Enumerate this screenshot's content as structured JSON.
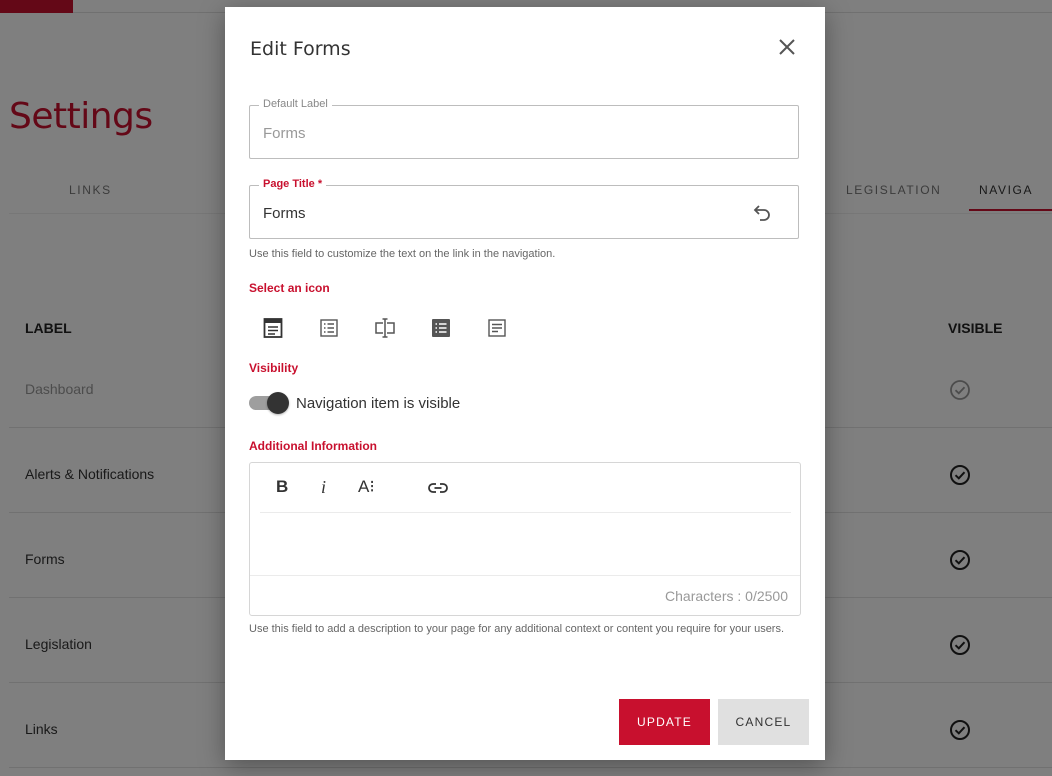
{
  "page": {
    "title": "Settings",
    "tabs": [
      {
        "label": "LINKS"
      },
      {
        "label": "LEGISLATION"
      },
      {
        "label": "NAVIGA"
      }
    ],
    "table": {
      "headers": {
        "label": "LABEL",
        "visible": "VISIBLE"
      },
      "rows": [
        {
          "label": "Dashboard",
          "icon": "check-circle-outline-icon"
        },
        {
          "label": "Alerts & Notifications",
          "icon": "check-circle-icon"
        },
        {
          "label": "Forms",
          "icon": "check-circle-icon"
        },
        {
          "label": "Legislation",
          "icon": "check-circle-icon"
        },
        {
          "label": "Links",
          "icon": "check-circle-icon"
        }
      ]
    }
  },
  "modal": {
    "title": "Edit Forms",
    "default_label": {
      "legend": "Default Label",
      "value": "Forms"
    },
    "page_title": {
      "legend": "Page Title *",
      "value": "Forms"
    },
    "page_title_help": "Use this field to customize the text on the link in the navigation.",
    "select_icon_label": "Select an icon",
    "icon_options": [
      "form-icon",
      "checklist-icon",
      "text-field-icon",
      "list-box-icon",
      "document-icon"
    ],
    "visibility_label": "Visibility",
    "visibility_toggle_label": "Navigation item is visible",
    "visibility_on": true,
    "additional_info_label": "Additional Information",
    "editor": {
      "bold": "B",
      "italic": "i",
      "font_size": "A⁝",
      "char_count": "Characters : 0/2500"
    },
    "additional_info_help": "Use this field to add a description to your page for any additional context or content you require for your users.",
    "update_label": "UPDATE",
    "cancel_label": "CANCEL"
  },
  "colors": {
    "accent": "#c8102e",
    "overlay": "rgba(0,0,0,0.5)",
    "cancel_bg": "#e0e0e0"
  }
}
